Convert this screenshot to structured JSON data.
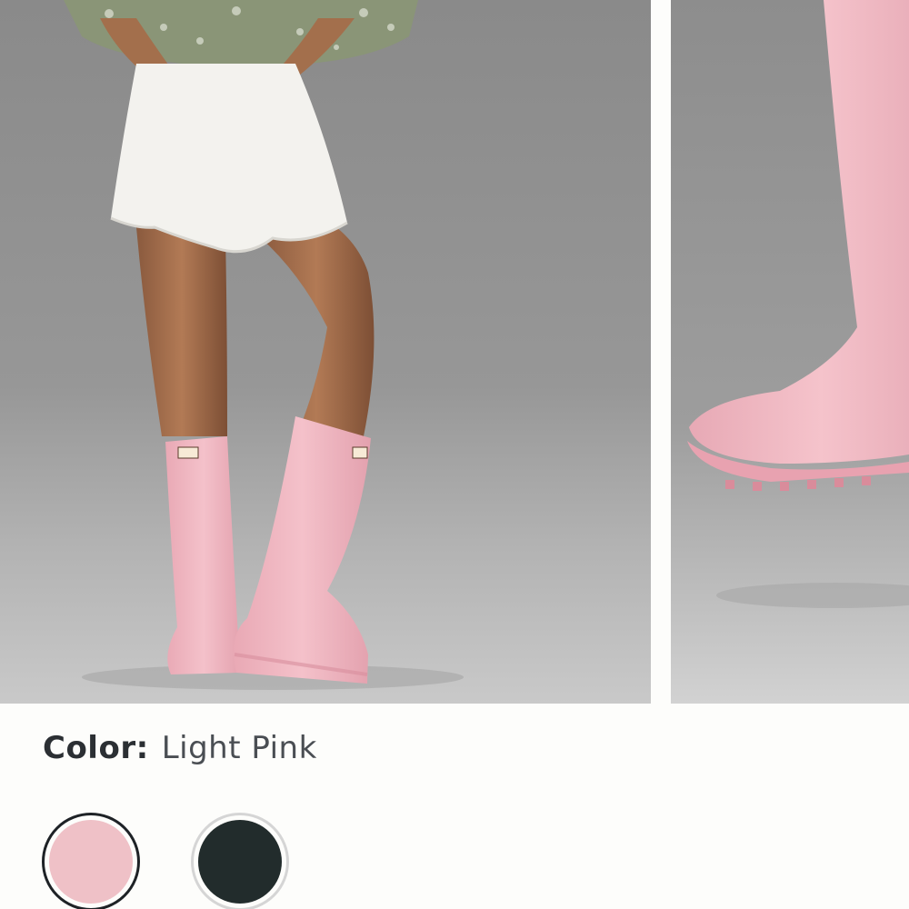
{
  "product": {
    "color_label": "Color:",
    "selected_color": "Light Pink"
  },
  "gallery": {
    "images": [
      {
        "icon": "model-wearing-boots-photo"
      },
      {
        "icon": "boot-closeup-photo"
      }
    ]
  },
  "swatches": [
    {
      "name": "Light Pink",
      "hex": "#efc1c7",
      "selected": true
    },
    {
      "name": "Black",
      "hex": "#222c2c",
      "selected": false
    }
  ],
  "colors": {
    "boot_pink": "#f2b9c2",
    "backdrop": "#8f8f8f",
    "page_bg": "#fdfdfb"
  }
}
